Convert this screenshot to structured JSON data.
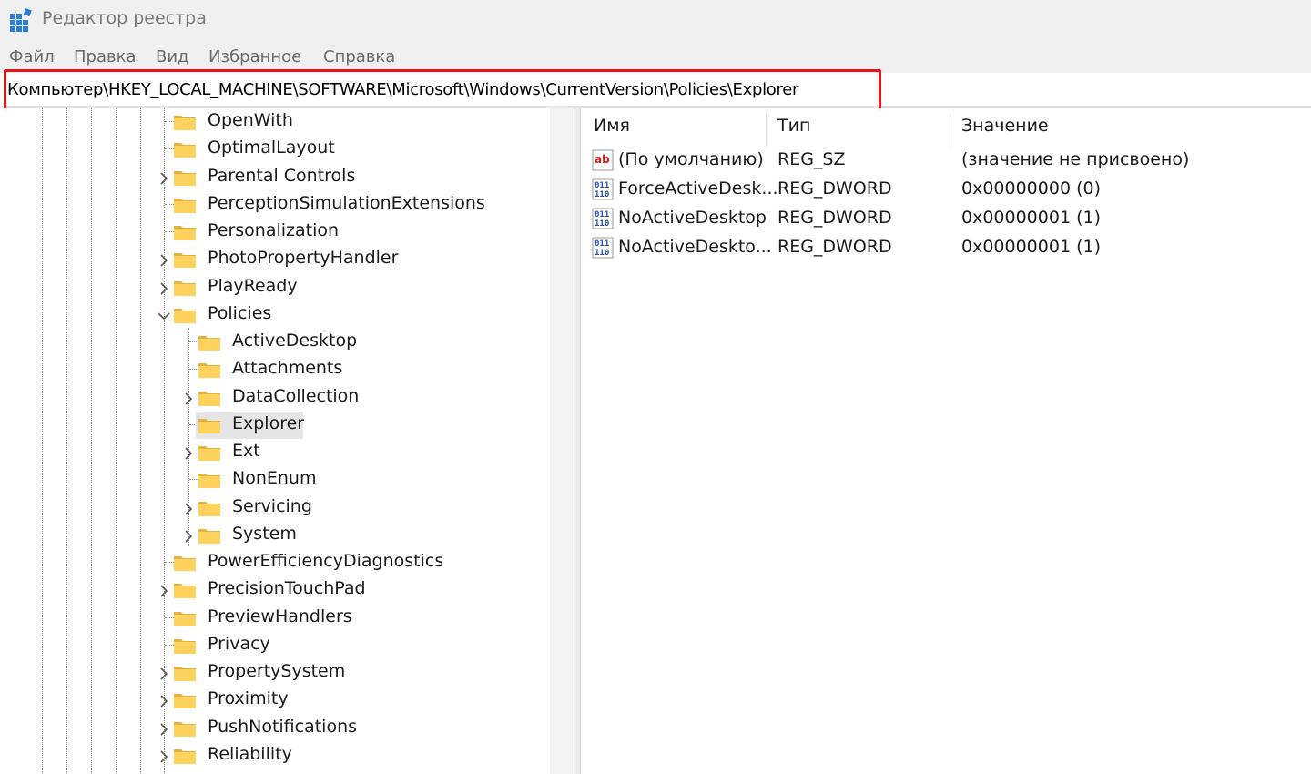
{
  "window": {
    "title": "Редактор реестра"
  },
  "menu": [
    "Файл",
    "Правка",
    "Вид",
    "Избранное",
    "Справка"
  ],
  "address": {
    "path": "Компьютер\\HKEY_LOCAL_MACHINE\\SOFTWARE\\Microsoft\\Windows\\CurrentVersion\\Policies\\Explorer",
    "highlight_color": "#e8141b"
  },
  "tree": {
    "items": [
      {
        "label": "OpenWith",
        "level": 0,
        "expander": "none"
      },
      {
        "label": "OptimalLayout",
        "level": 0,
        "expander": "none"
      },
      {
        "label": "Parental Controls",
        "level": 0,
        "expander": "collapsed"
      },
      {
        "label": "PerceptionSimulationExtensions",
        "level": 0,
        "expander": "none"
      },
      {
        "label": "Personalization",
        "level": 0,
        "expander": "none"
      },
      {
        "label": "PhotoPropertyHandler",
        "level": 0,
        "expander": "collapsed"
      },
      {
        "label": "PlayReady",
        "level": 0,
        "expander": "collapsed"
      },
      {
        "label": "Policies",
        "level": 0,
        "expander": "expanded"
      },
      {
        "label": "ActiveDesktop",
        "level": 1,
        "expander": "none"
      },
      {
        "label": "Attachments",
        "level": 1,
        "expander": "none"
      },
      {
        "label": "DataCollection",
        "level": 1,
        "expander": "collapsed"
      },
      {
        "label": "Explorer",
        "level": 1,
        "expander": "none",
        "selected": true
      },
      {
        "label": "Ext",
        "level": 1,
        "expander": "collapsed"
      },
      {
        "label": "NonEnum",
        "level": 1,
        "expander": "none"
      },
      {
        "label": "Servicing",
        "level": 1,
        "expander": "collapsed"
      },
      {
        "label": "System",
        "level": 1,
        "expander": "collapsed"
      },
      {
        "label": "PowerEfficiencyDiagnostics",
        "level": 0,
        "expander": "none"
      },
      {
        "label": "PrecisionTouchPad",
        "level": 0,
        "expander": "collapsed"
      },
      {
        "label": "PreviewHandlers",
        "level": 0,
        "expander": "none"
      },
      {
        "label": "Privacy",
        "level": 0,
        "expander": "none"
      },
      {
        "label": "PropertySystem",
        "level": 0,
        "expander": "collapsed"
      },
      {
        "label": "Proximity",
        "level": 0,
        "expander": "collapsed"
      },
      {
        "label": "PushNotifications",
        "level": 0,
        "expander": "collapsed"
      },
      {
        "label": "Reliability",
        "level": 0,
        "expander": "collapsed"
      }
    ]
  },
  "values_pane": {
    "columns": [
      "Имя",
      "Тип",
      "Значение"
    ],
    "rows": [
      {
        "icon": "string-value-icon",
        "name": "(По умолчанию)",
        "type": "REG_SZ",
        "data": "(значение не присвоено)"
      },
      {
        "icon": "binary-value-icon",
        "name": "ForceActiveDesk...",
        "type": "REG_DWORD",
        "data": "0x00000000 (0)"
      },
      {
        "icon": "binary-value-icon",
        "name": "NoActiveDesktop",
        "type": "REG_DWORD",
        "data": "0x00000001 (1)"
      },
      {
        "icon": "binary-value-icon",
        "name": "NoActiveDeskto...",
        "type": "REG_DWORD",
        "data": "0x00000001 (1)"
      }
    ]
  }
}
